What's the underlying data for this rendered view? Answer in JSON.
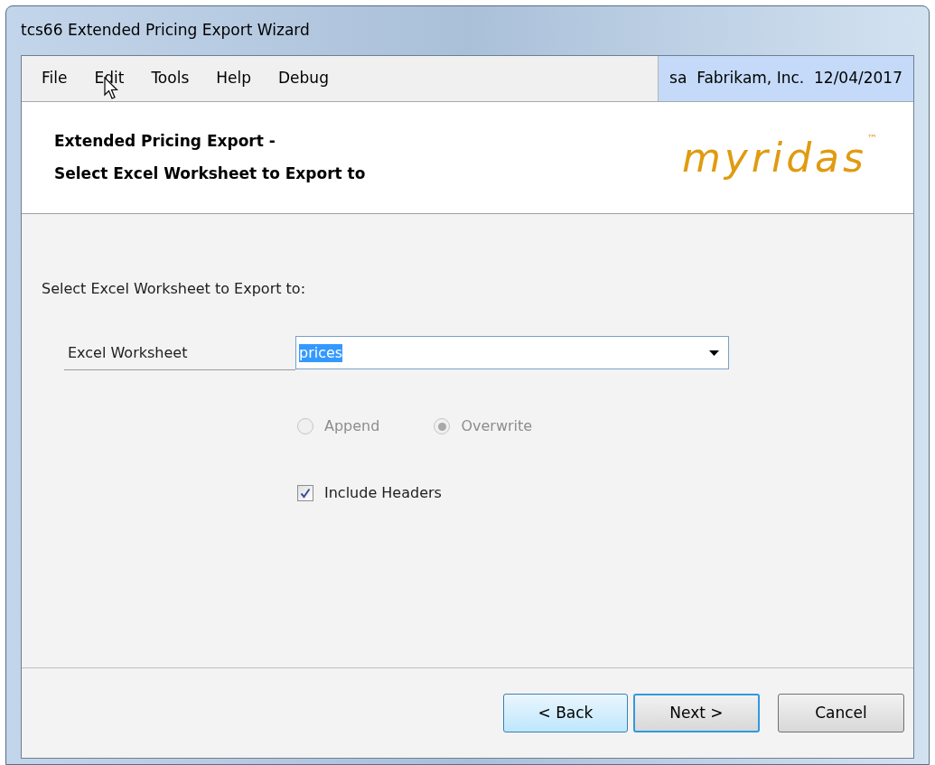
{
  "window": {
    "title": "tcs66 Extended Pricing Export Wizard"
  },
  "menu": [
    {
      "label": "File"
    },
    {
      "label": "Edit"
    },
    {
      "label": "Tools"
    },
    {
      "label": "Help"
    },
    {
      "label": "Debug"
    }
  ],
  "session": {
    "user": "sa",
    "company": "Fabrikam, Inc.",
    "date": "12/04/2017"
  },
  "header": {
    "lines": [
      "Extended Pricing Export -",
      "Select Excel Worksheet to Export to"
    ],
    "logo": "myridas",
    "logo_mark": "™"
  },
  "body": {
    "prompt": "Select Excel Worksheet to Export to:",
    "worksheet": {
      "label": "Excel Worksheet",
      "value": "prices"
    },
    "mode": [
      {
        "label": "Append",
        "selected": false,
        "disabled": true
      },
      {
        "label": "Overwrite",
        "selected": true,
        "disabled": true
      }
    ],
    "include_headers": {
      "label": "Include Headers",
      "checked": true
    }
  },
  "buttons": [
    {
      "label": "< Back",
      "hovered": true,
      "default": false
    },
    {
      "label": "Next >",
      "hovered": false,
      "default": true
    },
    {
      "label": "Cancel",
      "hovered": false,
      "default": false
    }
  ]
}
